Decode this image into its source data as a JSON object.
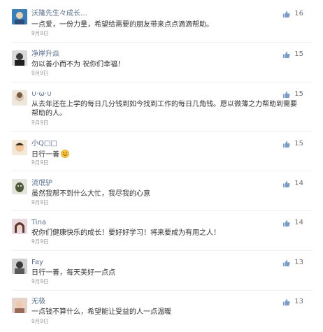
{
  "comments": [
    {
      "name": "沃隆先生々成长…",
      "text": "一点爱，一份力量，希望给需要的朋友带来点点滴滴帮助。",
      "date": "9月9日",
      "likes": "16",
      "avatar_color": "#3a7fb8"
    },
    {
      "name": "净岸升焱",
      "text": "勿以善小而不为  祝你们幸福！",
      "date": "9月9日",
      "likes": "15",
      "avatar_color": "#4a4a4a"
    },
    {
      "name": "∪·ω·∪",
      "text": "从去年还在上学的每日几分钱到如今找到工作的每日几角钱。愿以微薄之力帮助到需要帮助的人。",
      "date": "9月9日",
      "likes": "15",
      "avatar_color": "#d8c6b4"
    },
    {
      "name": "小Q□□",
      "text": "日行一善",
      "emoji": "smile-emoji-icon",
      "date": "9月9日",
      "likes": "15",
      "avatar_color": "#c49a70"
    },
    {
      "name": "流氓驴",
      "text": "虽然我帮不到什么大忙，我尽我的心意",
      "date": "9月9日",
      "likes": "14",
      "avatar_color": "#4e5a3a"
    },
    {
      "name": "Tina",
      "text": "祝你们健康快乐的成长！要好好学习！将来要成为有用之人！",
      "date": "9月9日",
      "likes": "14",
      "avatar_color": "#b58ea0"
    },
    {
      "name": "Fay",
      "text": "日行一善，每天美好一点点",
      "date": "9月9日",
      "likes": "13",
      "avatar_color": "#3b3b3b"
    },
    {
      "name": "无极",
      "text": "一点钱不算什么，希望能让受益的人一点温暖",
      "date": "9月9日",
      "likes": "13",
      "avatar_color": "#9a6a5a"
    }
  ],
  "icons": {
    "like": "thumbs-up-icon"
  },
  "colors": {
    "name": "#5b6f8c",
    "like_icon": "#7a9cc6",
    "date": "#9a9a9a"
  }
}
